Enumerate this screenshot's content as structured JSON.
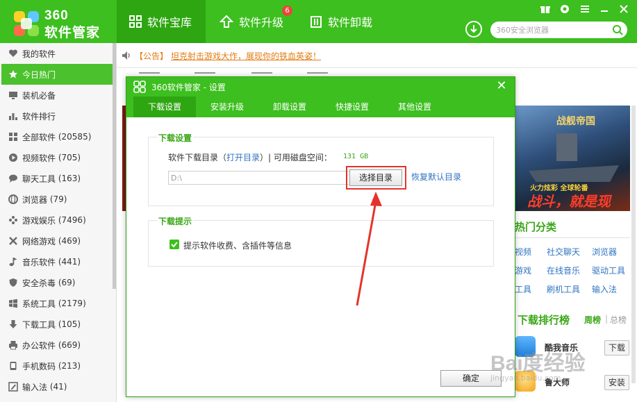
{
  "app": {
    "logo_number": "360",
    "logo_name": "软件管家"
  },
  "nav": {
    "tabs": [
      {
        "label": "软件宝库"
      },
      {
        "label": "软件升级",
        "badge": "6"
      },
      {
        "label": "软件卸载"
      }
    ]
  },
  "search": {
    "placeholder": "360安全浏览器"
  },
  "sidebar": {
    "items": [
      {
        "label": "我的软件",
        "icon": "heart-icon"
      },
      {
        "label": "今日热门",
        "icon": "star-icon"
      },
      {
        "label": "装机必备",
        "icon": "monitor-icon"
      },
      {
        "label": "软件排行",
        "icon": "bar-chart-icon"
      },
      {
        "label": "全部软件",
        "count": "(20585)",
        "icon": "grid-icon"
      },
      {
        "label": "视频软件",
        "count": "(705)",
        "icon": "play-icon"
      },
      {
        "label": "聊天工具",
        "count": "(163)",
        "icon": "chat-icon"
      },
      {
        "label": "浏览器",
        "count": "(79)",
        "icon": "globe-icon"
      },
      {
        "label": "游戏娱乐",
        "count": "(7496)",
        "icon": "gamepad-icon"
      },
      {
        "label": "网络游戏",
        "count": "(469)",
        "icon": "tools-icon"
      },
      {
        "label": "音乐软件",
        "count": "(441)",
        "icon": "music-icon"
      },
      {
        "label": "安全杀毒",
        "count": "(69)",
        "icon": "shield-icon"
      },
      {
        "label": "系统工具",
        "count": "(2179)",
        "icon": "windows-icon"
      },
      {
        "label": "下载工具",
        "count": "(105)",
        "icon": "download-icon"
      },
      {
        "label": "办公软件",
        "count": "(669)",
        "icon": "printer-icon"
      },
      {
        "label": "手机数码",
        "count": "(213)",
        "icon": "phone-icon"
      },
      {
        "label": "输入法",
        "count": "(41)",
        "icon": "pen-icon"
      }
    ]
  },
  "notice": {
    "label": "【公告】",
    "text": "坦克射击游戏大作，展现你的铁血英姿！"
  },
  "banner": {
    "title": "战舰帝国",
    "line1": "火力炫彩 全球轮番",
    "line2": "战斗，就是现在!"
  },
  "hot_categories": {
    "title": "热门分类",
    "items": [
      "视频",
      "社交聊天",
      "浏览器",
      "游戏",
      "在线音乐",
      "驱动工具",
      "工具",
      "刷机工具",
      "输入法"
    ]
  },
  "ranking": {
    "title": "下载排行榜",
    "tab_week": "周榜",
    "tab_all": "总榜",
    "apps": [
      {
        "name": "酷我音乐",
        "action": "下载"
      },
      {
        "name": "鲁大师",
        "action": "安装"
      }
    ]
  },
  "dialog": {
    "title": "360软件管家 - 设置",
    "tabs": [
      "下载设置",
      "安装升级",
      "卸载设置",
      "快捷设置",
      "其他设置"
    ],
    "download_group": {
      "title": "下载设置",
      "dir_label": "软件下载目录（",
      "open_dir": "打开目录",
      "dir_label_end": "）| 可用磁盘空间：",
      "free_space": "131 GB",
      "path_value": "D:\\",
      "browse_button": "选择目录",
      "restore_link": "恢复默认目录"
    },
    "tip_group": {
      "title": "下载提示",
      "checkbox_label": "提示软件收费、含插件等信息",
      "checked": true
    },
    "ok_button": "确定"
  },
  "colors": {
    "brand_green": "#3dbf1f",
    "active_green": "#2ea611",
    "highlight_red": "#e5332a",
    "link_blue": "#2f74c1",
    "notice_orange": "#e27b12"
  },
  "watermark": {
    "text": "Bai度经验",
    "sub": "jingyan.baidu.com"
  }
}
